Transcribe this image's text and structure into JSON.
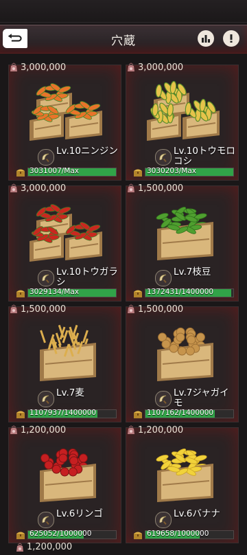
{
  "header": {
    "title": "穴蔵"
  },
  "cards": [
    {
      "cost": "3,000,000",
      "name": "Lv.10ニンジン",
      "progress_text": "3031007/Max",
      "progress_fraction": 1.0,
      "crop_icon": "carrot"
    },
    {
      "cost": "3,000,000",
      "name": "Lv.10トウモロコシ",
      "progress_text": "3030203/Max",
      "progress_fraction": 1.0,
      "crop_icon": "corn"
    },
    {
      "cost": "3,000,000",
      "name": "Lv.10トウガラシ",
      "progress_text": "3029134/Max",
      "progress_fraction": 1.0,
      "crop_icon": "chili"
    },
    {
      "cost": "1,500,000",
      "name": "Lv.7枝豆",
      "progress_text": "1372431/1400000",
      "progress_fraction": 0.98,
      "crop_icon": "edamame"
    },
    {
      "cost": "1,500,000",
      "name": "Lv.7麦",
      "progress_text": "1107937/1400000",
      "progress_fraction": 0.79,
      "crop_icon": "wheat"
    },
    {
      "cost": "1,500,000",
      "name": "Lv.7ジャガイモ",
      "progress_text": "1107162/1400000",
      "progress_fraction": 0.79,
      "crop_icon": "potato"
    },
    {
      "cost": "1,200,000",
      "name": "Lv.6リンゴ",
      "progress_text": "625052/1000000",
      "progress_fraction": 0.63,
      "crop_icon": "apple"
    },
    {
      "cost": "1,200,000",
      "name": "Lv.6バナナ",
      "progress_text": "619658/1000000",
      "progress_fraction": 0.62,
      "crop_icon": "banana"
    }
  ],
  "next_cost": "1,200,000",
  "colors": {
    "progress": "#31a348",
    "background": "#1a1718",
    "card": "#2a2324"
  }
}
